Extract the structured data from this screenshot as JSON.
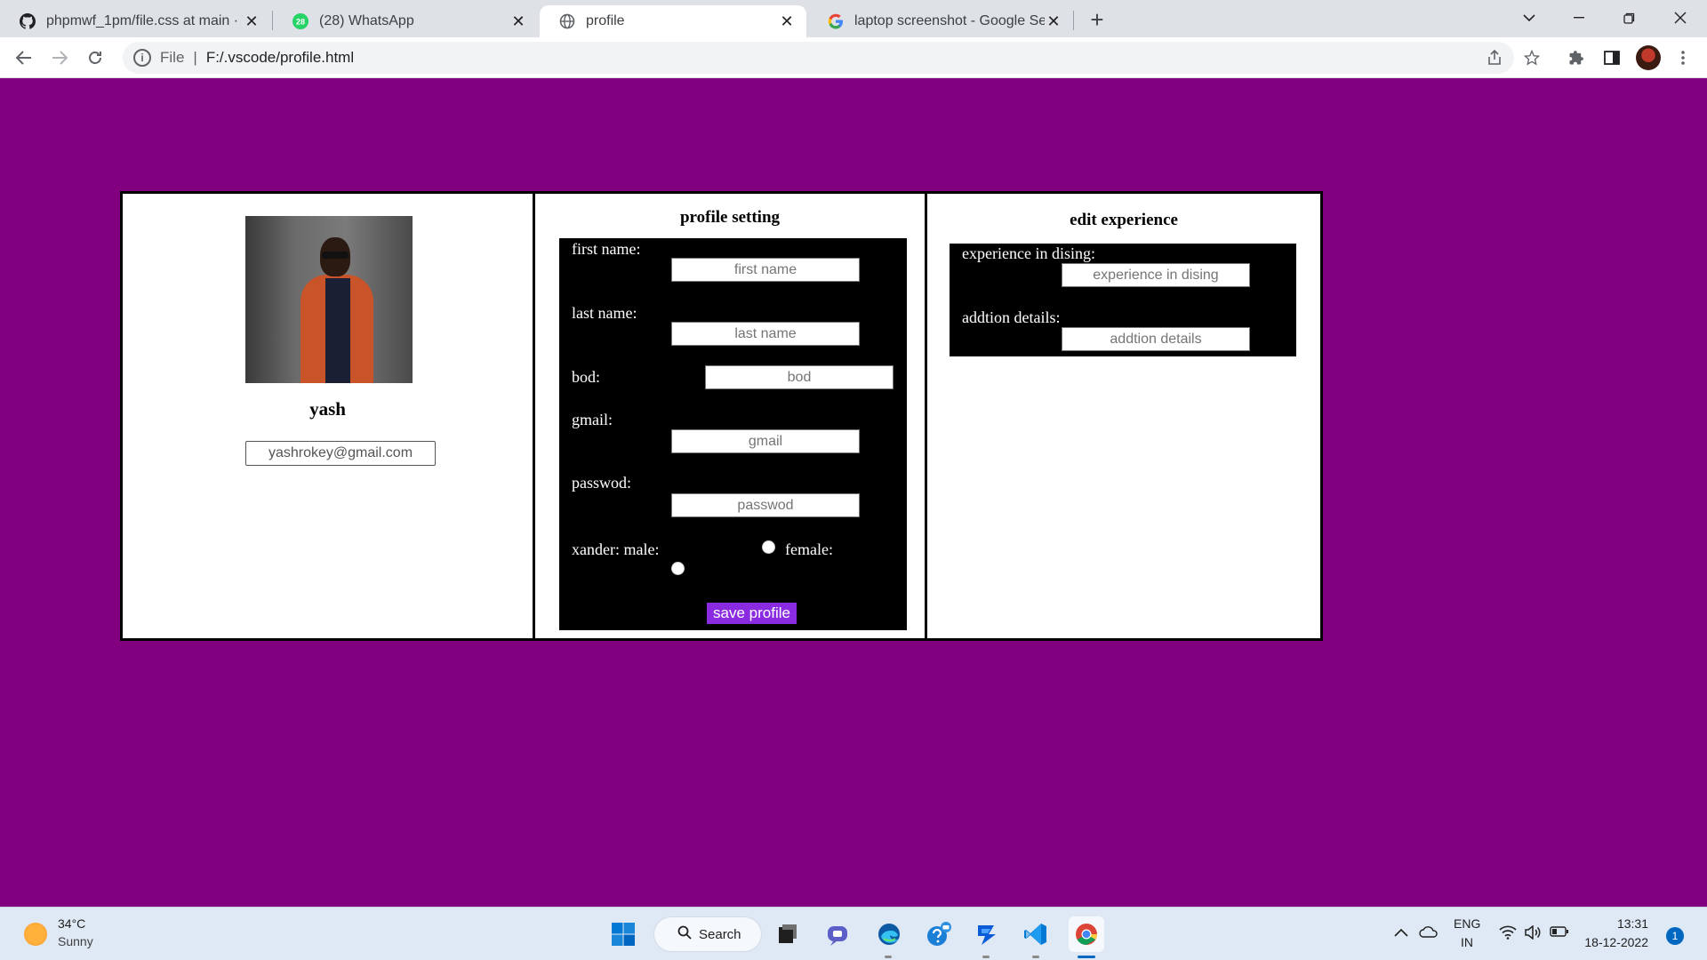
{
  "browser": {
    "tabs": [
      {
        "title": "phpmwf_1pm/file.css at main · Ya",
        "icon": "github-icon"
      },
      {
        "title": "(28) WhatsApp",
        "icon": "whatsapp-icon",
        "badge": "28"
      },
      {
        "title": "profile",
        "icon": "globe-icon",
        "active": true
      },
      {
        "title": "laptop screenshot - Google Searc",
        "icon": "google-icon"
      }
    ],
    "address": {
      "scheme": "File",
      "url": "F:/.vscode/profile.html"
    }
  },
  "profile_card": {
    "name": "yash",
    "email": "yashrokey@gmail.com"
  },
  "profile_setting": {
    "heading": "profile setting",
    "fields": {
      "first_name": {
        "label": "first name:",
        "placeholder": "first name"
      },
      "last_name": {
        "label": "last name:",
        "placeholder": "last name"
      },
      "bod": {
        "label": "bod:",
        "placeholder": "bod"
      },
      "gmail": {
        "label": "gmail:",
        "placeholder": "gmail"
      },
      "passwod": {
        "label": "passwod:",
        "placeholder": "passwod"
      }
    },
    "gender": {
      "label_male": "xander: male:",
      "label_female": "female:"
    },
    "save_label": "save profile",
    "save_color": "#8a2be2"
  },
  "edit_experience": {
    "heading": "edit experience",
    "fields": {
      "experience": {
        "label": "experience in dising:",
        "placeholder": "experience in dising"
      },
      "details": {
        "label": "addtion details:",
        "placeholder": "addtion details"
      }
    }
  },
  "page_background": "#800080",
  "taskbar": {
    "weather": {
      "temp": "34°C",
      "desc": "Sunny"
    },
    "search_label": "Search",
    "lang": {
      "line1": "ENG",
      "line2": "IN"
    },
    "clock": {
      "time": "13:31",
      "date": "18-12-2022"
    },
    "notifications": "1"
  }
}
